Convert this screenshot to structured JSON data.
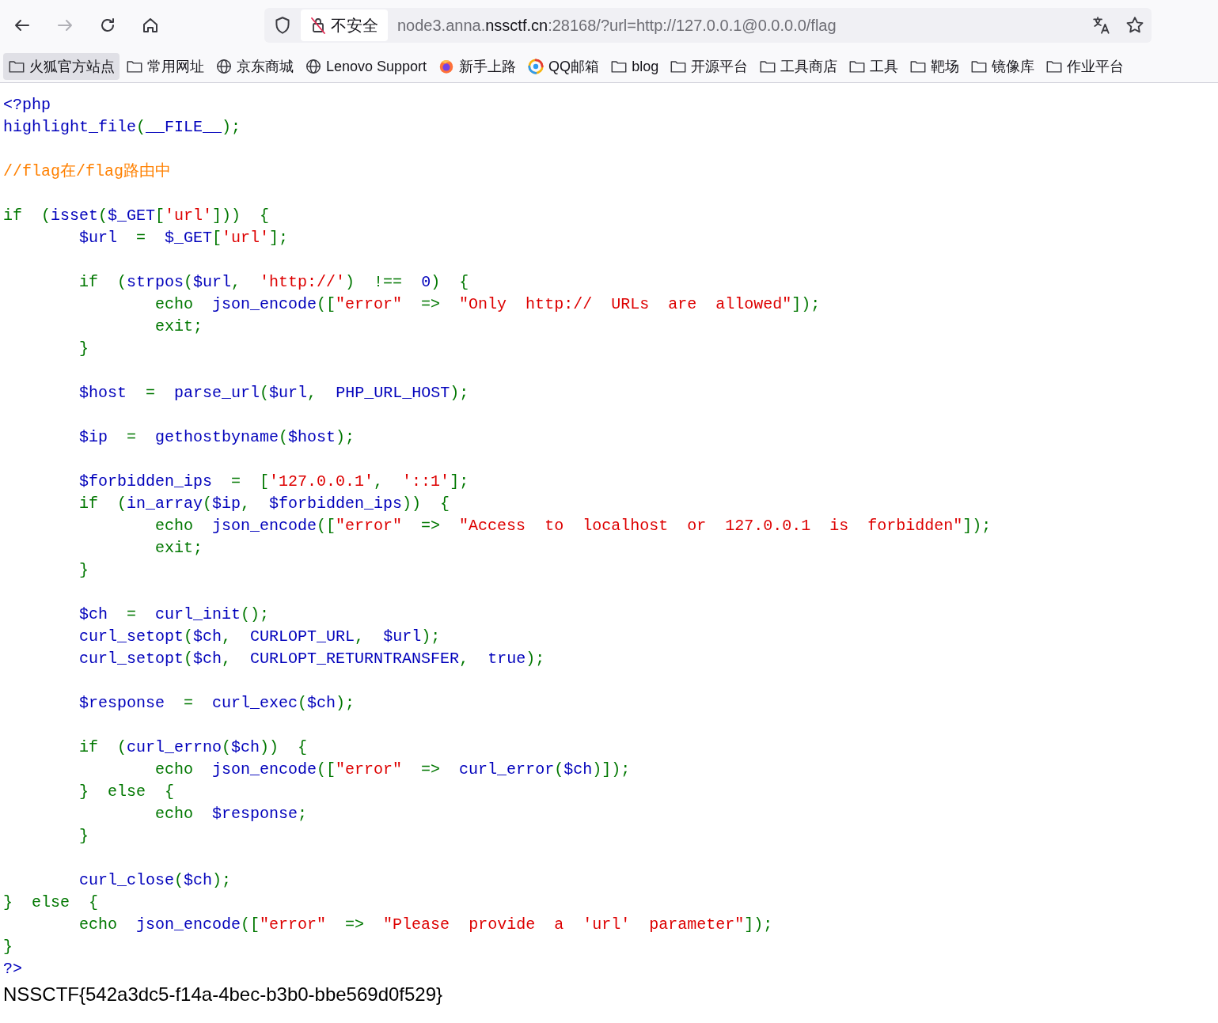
{
  "toolbar": {
    "nav": [
      {
        "kind": "back",
        "disabled": false
      },
      {
        "kind": "forward",
        "disabled": true
      },
      {
        "kind": "reload",
        "disabled": false
      },
      {
        "kind": "home",
        "disabled": false
      }
    ],
    "security_label": "不安全",
    "url": {
      "subdomain": "node3.anna.",
      "domain": "nssctf.cn",
      "path": ":28168/?url=http://127.0.0.1@0.0.0.0/flag"
    }
  },
  "bookmarks": [
    {
      "label": "火狐官方站点",
      "kind": "folder",
      "selected": true
    },
    {
      "label": "常用网址",
      "kind": "folder",
      "selected": false
    },
    {
      "label": "京东商城",
      "kind": "site",
      "selected": false
    },
    {
      "label": "Lenovo Support",
      "kind": "site",
      "selected": false
    },
    {
      "label": "新手上路",
      "kind": "browser",
      "selected": false
    },
    {
      "label": "QQ邮箱",
      "kind": "mail",
      "selected": false
    },
    {
      "label": "blog",
      "kind": "folder",
      "selected": false
    },
    {
      "label": "开源平台",
      "kind": "folder",
      "selected": false
    },
    {
      "label": "工具商店",
      "kind": "folder",
      "selected": false
    },
    {
      "label": "工具",
      "kind": "folder",
      "selected": false
    },
    {
      "label": "靶场",
      "kind": "folder",
      "selected": false
    },
    {
      "label": "镜像库",
      "kind": "folder",
      "selected": false
    },
    {
      "label": "作业平台",
      "kind": "folder",
      "selected": false
    }
  ],
  "source_code": {
    "blocks": [
      [
        [
          {
            "kind": "default",
            "text": "<?php"
          }
        ],
        [
          {
            "kind": "default",
            "text": "highlight_file"
          },
          {
            "kind": "keyword",
            "text": "("
          },
          {
            "kind": "default",
            "text": "__FILE__"
          },
          {
            "kind": "keyword",
            "text": ");"
          }
        ]
      ],
      [
        [
          {
            "kind": "comment",
            "text": "//flag在/flag路由中"
          }
        ]
      ],
      [
        [
          {
            "kind": "keyword",
            "text": "if ("
          },
          {
            "kind": "default",
            "text": "isset"
          },
          {
            "kind": "keyword",
            "text": "("
          },
          {
            "kind": "default",
            "text": "$_GET"
          },
          {
            "kind": "keyword",
            "text": "["
          },
          {
            "kind": "string",
            "text": "'url'"
          },
          {
            "kind": "keyword",
            "text": "])) {"
          }
        ],
        [
          {
            "kind": "default",
            "text": "    $url"
          },
          {
            "kind": "keyword",
            "text": " = "
          },
          {
            "kind": "default",
            "text": "$_GET"
          },
          {
            "kind": "keyword",
            "text": "["
          },
          {
            "kind": "string",
            "text": "'url'"
          },
          {
            "kind": "keyword",
            "text": "];"
          }
        ]
      ],
      [
        [
          {
            "kind": "keyword",
            "text": "    if ("
          },
          {
            "kind": "default",
            "text": "strpos"
          },
          {
            "kind": "keyword",
            "text": "("
          },
          {
            "kind": "default",
            "text": "$url"
          },
          {
            "kind": "keyword",
            "text": ", "
          },
          {
            "kind": "string",
            "text": "'http://'"
          },
          {
            "kind": "keyword",
            "text": ") !== "
          },
          {
            "kind": "default",
            "text": "0"
          },
          {
            "kind": "keyword",
            "text": ") {"
          }
        ],
        [
          {
            "kind": "keyword",
            "text": "        echo "
          },
          {
            "kind": "default",
            "text": "json_encode"
          },
          {
            "kind": "keyword",
            "text": "(["
          },
          {
            "kind": "string",
            "text": "\"error\""
          },
          {
            "kind": "keyword",
            "text": " => "
          },
          {
            "kind": "string",
            "text": "\"Only http:// URLs are allowed\""
          },
          {
            "kind": "keyword",
            "text": "]);"
          }
        ],
        [
          {
            "kind": "keyword",
            "text": "        exit;"
          }
        ],
        [
          {
            "kind": "keyword",
            "text": "    }"
          }
        ]
      ],
      [
        [
          {
            "kind": "default",
            "text": "    $host"
          },
          {
            "kind": "keyword",
            "text": " = "
          },
          {
            "kind": "default",
            "text": "parse_url"
          },
          {
            "kind": "keyword",
            "text": "("
          },
          {
            "kind": "default",
            "text": "$url"
          },
          {
            "kind": "keyword",
            "text": ", "
          },
          {
            "kind": "default",
            "text": "PHP_URL_HOST"
          },
          {
            "kind": "keyword",
            "text": ");"
          }
        ]
      ],
      [
        [
          {
            "kind": "default",
            "text": "    $ip"
          },
          {
            "kind": "keyword",
            "text": " = "
          },
          {
            "kind": "default",
            "text": "gethostbyname"
          },
          {
            "kind": "keyword",
            "text": "("
          },
          {
            "kind": "default",
            "text": "$host"
          },
          {
            "kind": "keyword",
            "text": ");"
          }
        ]
      ],
      [
        [
          {
            "kind": "default",
            "text": "    $forbidden_ips"
          },
          {
            "kind": "keyword",
            "text": " = ["
          },
          {
            "kind": "string",
            "text": "'127.0.0.1'"
          },
          {
            "kind": "keyword",
            "text": ", "
          },
          {
            "kind": "string",
            "text": "'::1'"
          },
          {
            "kind": "keyword",
            "text": "];"
          }
        ],
        [
          {
            "kind": "keyword",
            "text": "    if ("
          },
          {
            "kind": "default",
            "text": "in_array"
          },
          {
            "kind": "keyword",
            "text": "("
          },
          {
            "kind": "default",
            "text": "$ip"
          },
          {
            "kind": "keyword",
            "text": ", "
          },
          {
            "kind": "default",
            "text": "$forbidden_ips"
          },
          {
            "kind": "keyword",
            "text": ")) {"
          }
        ],
        [
          {
            "kind": "keyword",
            "text": "        echo "
          },
          {
            "kind": "default",
            "text": "json_encode"
          },
          {
            "kind": "keyword",
            "text": "(["
          },
          {
            "kind": "string",
            "text": "\"error\""
          },
          {
            "kind": "keyword",
            "text": " => "
          },
          {
            "kind": "string",
            "text": "\"Access to localhost or 127.0.0.1 is forbidden\""
          },
          {
            "kind": "keyword",
            "text": "]);"
          }
        ],
        [
          {
            "kind": "keyword",
            "text": "        exit;"
          }
        ],
        [
          {
            "kind": "keyword",
            "text": "    }"
          }
        ]
      ],
      [
        [
          {
            "kind": "default",
            "text": "    $ch"
          },
          {
            "kind": "keyword",
            "text": " = "
          },
          {
            "kind": "default",
            "text": "curl_init"
          },
          {
            "kind": "keyword",
            "text": "();"
          }
        ],
        [
          {
            "kind": "default",
            "text": "    curl_setopt"
          },
          {
            "kind": "keyword",
            "text": "("
          },
          {
            "kind": "default",
            "text": "$ch"
          },
          {
            "kind": "keyword",
            "text": ", "
          },
          {
            "kind": "default",
            "text": "CURLOPT_URL"
          },
          {
            "kind": "keyword",
            "text": ", "
          },
          {
            "kind": "default",
            "text": "$url"
          },
          {
            "kind": "keyword",
            "text": ");"
          }
        ],
        [
          {
            "kind": "default",
            "text": "    curl_setopt"
          },
          {
            "kind": "keyword",
            "text": "("
          },
          {
            "kind": "default",
            "text": "$ch"
          },
          {
            "kind": "keyword",
            "text": ", "
          },
          {
            "kind": "default",
            "text": "CURLOPT_RETURNTRANSFER"
          },
          {
            "kind": "keyword",
            "text": ", "
          },
          {
            "kind": "default",
            "text": "true"
          },
          {
            "kind": "keyword",
            "text": ");"
          }
        ]
      ],
      [
        [
          {
            "kind": "default",
            "text": "    $response"
          },
          {
            "kind": "keyword",
            "text": " = "
          },
          {
            "kind": "default",
            "text": "curl_exec"
          },
          {
            "kind": "keyword",
            "text": "("
          },
          {
            "kind": "default",
            "text": "$ch"
          },
          {
            "kind": "keyword",
            "text": ");"
          }
        ]
      ],
      [
        [
          {
            "kind": "keyword",
            "text": "    if ("
          },
          {
            "kind": "default",
            "text": "curl_errno"
          },
          {
            "kind": "keyword",
            "text": "("
          },
          {
            "kind": "default",
            "text": "$ch"
          },
          {
            "kind": "keyword",
            "text": ")) {"
          }
        ],
        [
          {
            "kind": "keyword",
            "text": "        echo "
          },
          {
            "kind": "default",
            "text": "json_encode"
          },
          {
            "kind": "keyword",
            "text": "(["
          },
          {
            "kind": "string",
            "text": "\"error\""
          },
          {
            "kind": "keyword",
            "text": " => "
          },
          {
            "kind": "default",
            "text": "curl_error"
          },
          {
            "kind": "keyword",
            "text": "("
          },
          {
            "kind": "default",
            "text": "$ch"
          },
          {
            "kind": "keyword",
            "text": ")]);"
          }
        ],
        [
          {
            "kind": "keyword",
            "text": "    } else {"
          }
        ],
        [
          {
            "kind": "keyword",
            "text": "        echo "
          },
          {
            "kind": "default",
            "text": "$response"
          },
          {
            "kind": "keyword",
            "text": ";"
          }
        ],
        [
          {
            "kind": "keyword",
            "text": "    }"
          }
        ]
      ],
      [
        [
          {
            "kind": "default",
            "text": "    curl_close"
          },
          {
            "kind": "keyword",
            "text": "("
          },
          {
            "kind": "default",
            "text": "$ch"
          },
          {
            "kind": "keyword",
            "text": ");"
          }
        ],
        [
          {
            "kind": "keyword",
            "text": "} else {"
          }
        ],
        [
          {
            "kind": "keyword",
            "text": "    echo "
          },
          {
            "kind": "default",
            "text": "json_encode"
          },
          {
            "kind": "keyword",
            "text": "(["
          },
          {
            "kind": "string",
            "text": "\"error\""
          },
          {
            "kind": "keyword",
            "text": " => "
          },
          {
            "kind": "string",
            "text": "\"Please provide a 'url' parameter\""
          },
          {
            "kind": "keyword",
            "text": "]);"
          }
        ],
        [
          {
            "kind": "keyword",
            "text": "}"
          }
        ],
        [
          {
            "kind": "default",
            "text": "?>"
          }
        ]
      ]
    ]
  },
  "output": "NSSCTF{542a3dc5-f14a-4bec-b3b0-bbe569d0f529}"
}
